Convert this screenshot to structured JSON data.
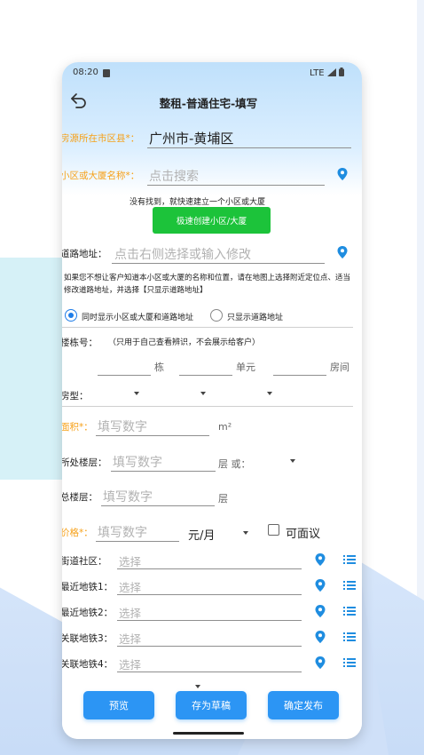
{
  "status": {
    "time": "08:20",
    "network": "LTE"
  },
  "header": {
    "title": "整租-普通住宅-填写"
  },
  "form": {
    "district": {
      "label": "房源所在市区县*：",
      "value": "广州市-黄埔区"
    },
    "community": {
      "label": "小区或大厦名称*：",
      "placeholder": "点击搜索"
    },
    "not_found_text": "没有找到，就快速建立一个小区或大厦",
    "quick_create_button": "极速创建小区/大厦",
    "road": {
      "label": "道路地址：",
      "placeholder": "点击右侧选择或输入修改"
    },
    "road_note": "如果您不想让客户知道本小区或大厦的名称和位置，请在地图上选择附近定位点、适当修改道路地址，并选择【只显示道路地址】",
    "display_options": [
      "同时显示小区或大厦和道路地址",
      "只显示道路地址"
    ],
    "building": {
      "label": "楼栋号：",
      "hint": "（只用于自己查看辨识，不会展示给客户）",
      "units": [
        "栋",
        "单元",
        "房间"
      ]
    },
    "layout_label": "房型：",
    "area": {
      "label": "面积*：",
      "placeholder": "填写数字",
      "unit": "m²"
    },
    "floor": {
      "label": "所处楼层：",
      "placeholder": "填写数字",
      "unit": "层 或："
    },
    "total_floors": {
      "label": "总楼层：",
      "placeholder": "填写数字",
      "unit": "层"
    },
    "price": {
      "label": "价格*：",
      "placeholder": "填写数字",
      "unit": "元/月",
      "negotiable": "可面议"
    },
    "selects": [
      {
        "label": "街道社区：",
        "placeholder": "选择"
      },
      {
        "label": "最近地铁1：",
        "placeholder": "选择"
      },
      {
        "label": "最近地铁2：",
        "placeholder": "选择"
      },
      {
        "label": "关联地铁3：",
        "placeholder": "选择"
      },
      {
        "label": "关联地铁4：",
        "placeholder": "选择"
      }
    ]
  },
  "bottom": {
    "preview": "预览",
    "save_draft": "存为草稿",
    "publish": "确定发布"
  },
  "colors": {
    "accent": "#2c95f4",
    "required": "#f6a11a",
    "green": "#1cc33a",
    "pin": "#1f8de0"
  }
}
